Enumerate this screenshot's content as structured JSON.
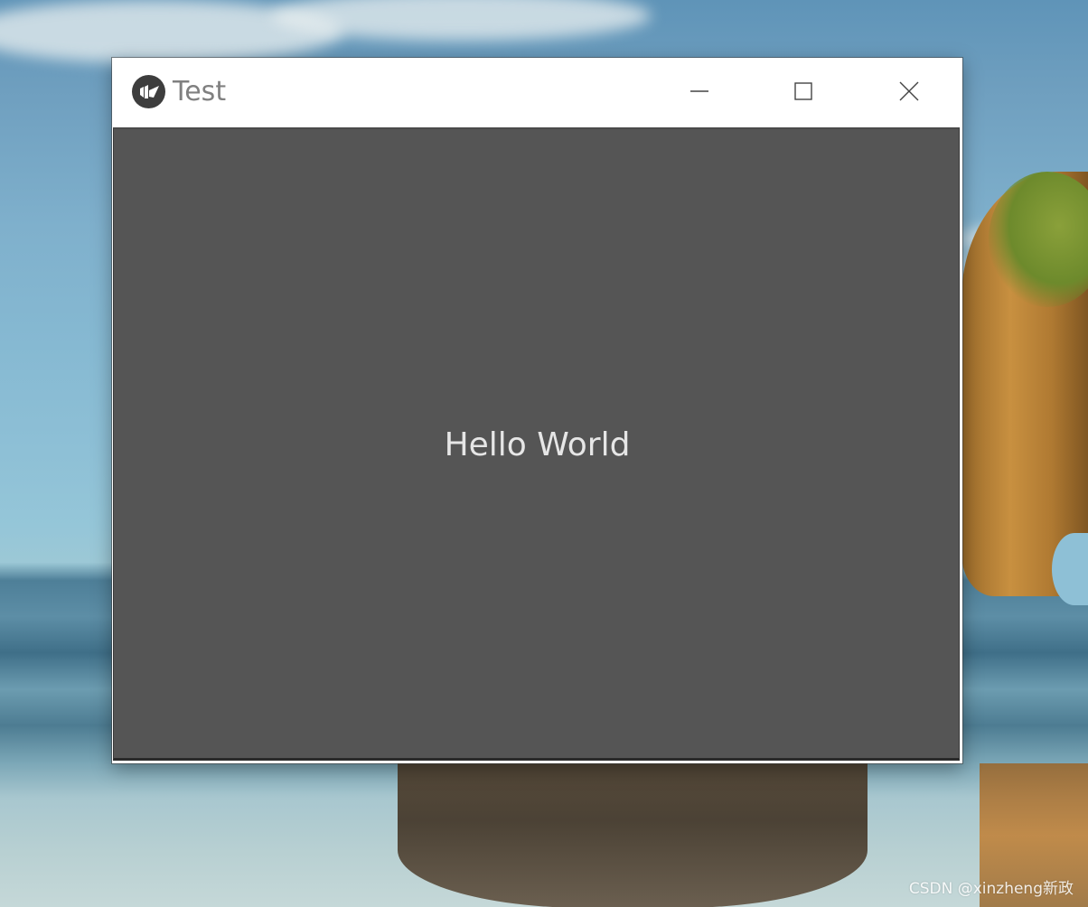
{
  "window": {
    "title": "Test",
    "app_icon": "kivy-logo-icon",
    "controls": {
      "minimize_icon": "minimize-icon",
      "maximize_icon": "maximize-icon",
      "close_icon": "close-icon"
    }
  },
  "content": {
    "label": "Hello World",
    "background_color": "#555555",
    "text_color": "#e6e6e6"
  },
  "watermark": {
    "text": "CSDN @xinzheng新政"
  }
}
